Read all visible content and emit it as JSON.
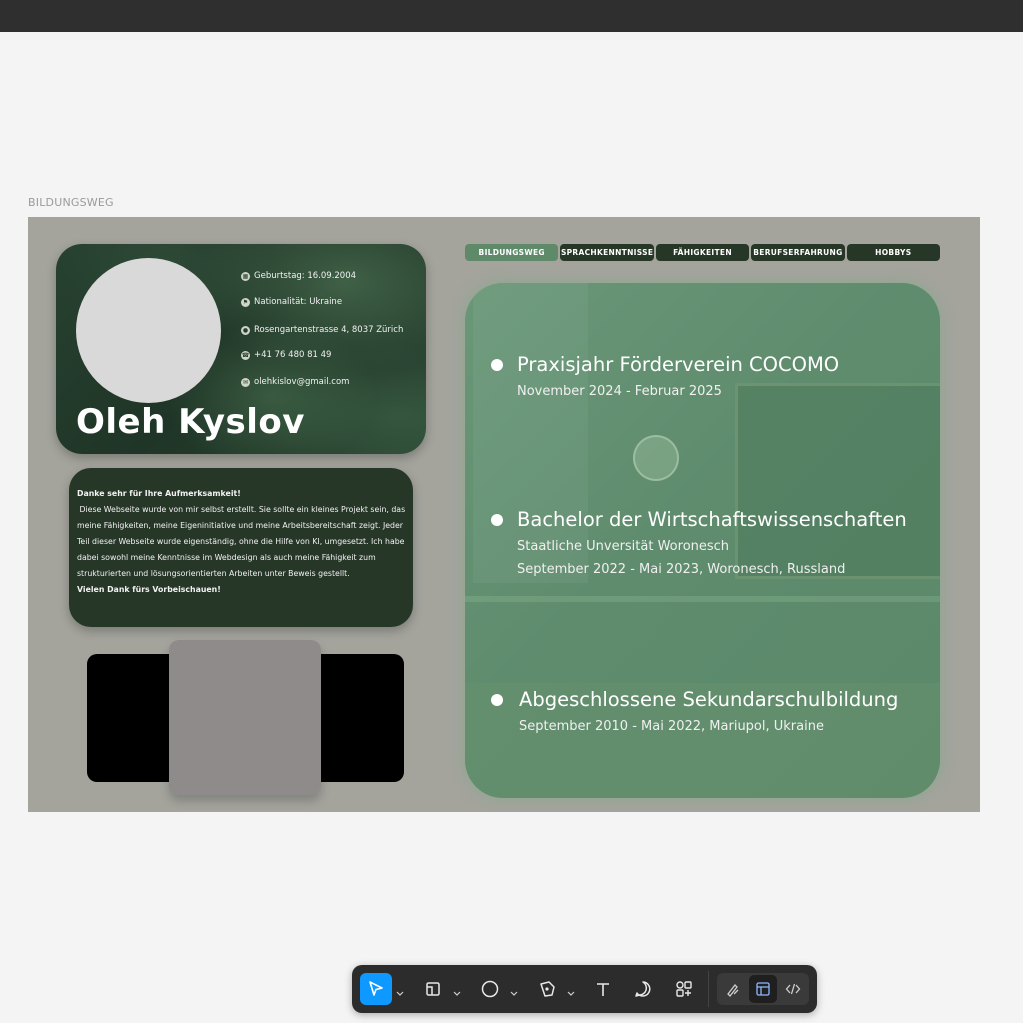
{
  "frame": {
    "label": "BILDUNGSWEG"
  },
  "profile": {
    "name": "Oleh Kyslov",
    "birthday": "Geburtstag: 16.09.2004",
    "nationality": "Nationalität: Ukraine",
    "address": "Rosengartenstrasse 4, 8037 Zürich",
    "phone": "+41 76 480 81 49",
    "email": "olehkislov@gmail.com"
  },
  "message": {
    "heading": "Danke sehr für Ihre Aufmerksamkeit!",
    "body": "Diese Webseite wurde von mir selbst erstellt. Sie sollte ein kleines Projekt sein, das meine Fähigkeiten, meine Eigeninitiative und meine Arbeitsbereitschaft zeigt. Jeder Teil dieser Webseite wurde eigenständig, ohne die Hilfe von KI, umgesetzt. Ich habe dabei sowohl meine Kenntnisse im Webdesign als auch meine Fähigkeit zum strukturierten und lösungsorientierten Arbeiten unter Beweis gestellt.",
    "closing": "Vielen Dank fürs Vorbeischauen!"
  },
  "nav": {
    "tabs": [
      "BILDUNGSWEG",
      "SPRACHKENNTNISSE",
      "FÄHIGKEITEN",
      "BERUFSERFAHRUNG",
      "HOBBYS"
    ],
    "active": "BILDUNGSWEG"
  },
  "education": [
    {
      "title": "Praxisjahr Förderverein COCOMO",
      "lines": [
        "November 2024 - Februar 2025"
      ]
    },
    {
      "title": "Bachelor der Wirtschaftswissenschaften",
      "lines": [
        "Staatliche Unversität Woronesch",
        "September 2022 - Mai 2023, Woronesch, Russland"
      ]
    },
    {
      "title": "Abgeschlossene Sekundarschulbildung",
      "lines": [
        "September 2010 - Mai 2022, Mariupol, Ukraine"
      ]
    }
  ],
  "colors": {
    "accent": "#0d99ff",
    "card_dark": "#263728",
    "panel_green": "#5e8c6d",
    "frame_bg": "#a4a49d"
  },
  "toolbar": {
    "tools": [
      "move-tool",
      "frame-tool",
      "shape-tool",
      "pen-tool",
      "text-tool",
      "comment-tool",
      "assets-tool",
      "draw-mode",
      "design-mode",
      "dev-mode"
    ],
    "active": "move-tool"
  }
}
